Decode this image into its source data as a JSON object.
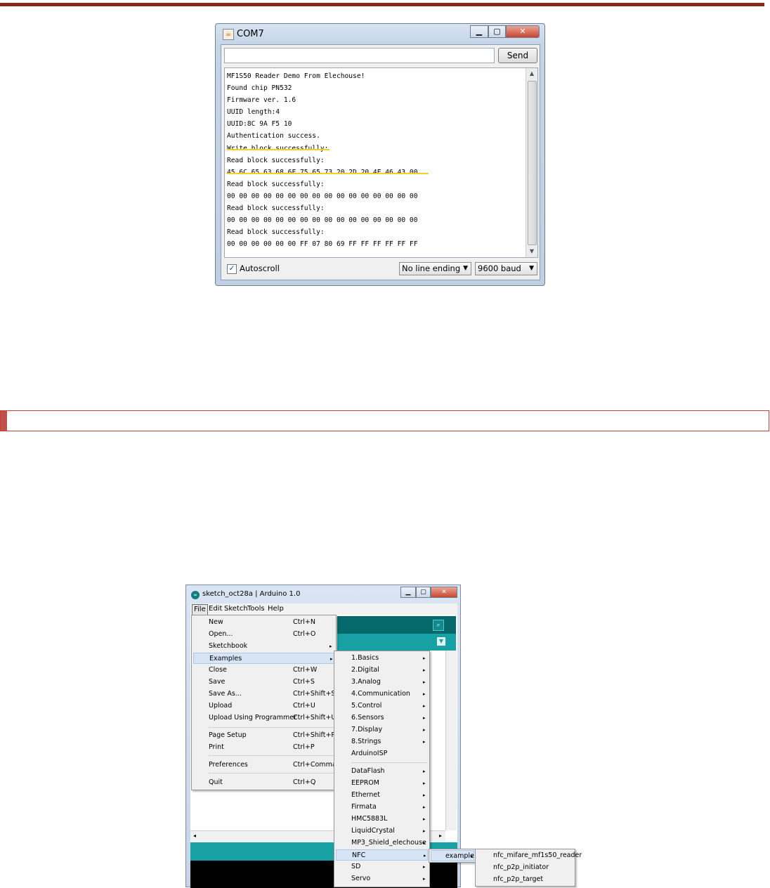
{
  "serial_window": {
    "title": "COM7",
    "send_label": "Send",
    "input_value": "",
    "output_lines": [
      "MF1S50 Reader Demo From Elechouse!",
      "Found chip PN532",
      "Firmware ver. 1.6",
      "UUID length:4",
      "UUID:8C 9A F5 10",
      "Authentication success.",
      "Write block successfully:",
      "Read block successfully:",
      "45 6C 65 63 68 6F 75 65 73 20 2D 20 4E 46 43 00",
      "Read block successfully:",
      "00 00 00 00 00 00 00 00 00 00 00 00 00 00 00 00",
      "Read block successfully:",
      "00 00 00 00 00 00 00 00 00 00 00 00 00 00 00 00",
      "Read block successfully:",
      "00 00 00 00 00 00 FF 07 80 69 FF FF FF FF FF FF"
    ],
    "autoscroll_label": "Autoscroll",
    "autoscroll_checked": true,
    "line_ending": "No line ending",
    "baud": "9600 baud"
  },
  "arduino_window": {
    "title": "sketch_oct28a | Arduino 1.0",
    "menubar": [
      "File",
      "Edit",
      "Sketch",
      "Tools",
      "Help"
    ],
    "file_menu": [
      {
        "label": "New",
        "shortcut": "Ctrl+N"
      },
      {
        "label": "Open...",
        "shortcut": "Ctrl+O"
      },
      {
        "label": "Sketchbook",
        "shortcut": ""
      },
      {
        "label": "Examples",
        "shortcut": ""
      },
      {
        "label": "Close",
        "shortcut": "Ctrl+W"
      },
      {
        "label": "Save",
        "shortcut": "Ctrl+S"
      },
      {
        "label": "Save As...",
        "shortcut": "Ctrl+Shift+S"
      },
      {
        "label": "Upload",
        "shortcut": "Ctrl+U"
      },
      {
        "label": "Upload Using Programmer",
        "shortcut": "Ctrl+Shift+U"
      },
      {
        "label": "Page Setup",
        "shortcut": "Ctrl+Shift+P"
      },
      {
        "label": "Print",
        "shortcut": "Ctrl+P"
      },
      {
        "label": "Preferences",
        "shortcut": "Ctrl+Comma"
      },
      {
        "label": "Quit",
        "shortcut": "Ctrl+Q"
      }
    ],
    "examples_menu": [
      "1.Basics",
      "2.Digital",
      "3.Analog",
      "4.Communication",
      "5.Control",
      "6.Sensors",
      "7.Display",
      "8.Strings",
      "ArduinoISP",
      "DataFlash",
      "EEPROM",
      "Ethernet",
      "Firmata",
      "HMC5883L",
      "LiquidCrystal",
      "MP3_Shield_elechouse",
      "NFC",
      "SD",
      "Servo"
    ],
    "nfc_menu": [
      "example"
    ],
    "example_menu": [
      "nfc_mifare_mf1s50_reader",
      "nfc_p2p_initiator",
      "nfc_p2p_target"
    ]
  }
}
